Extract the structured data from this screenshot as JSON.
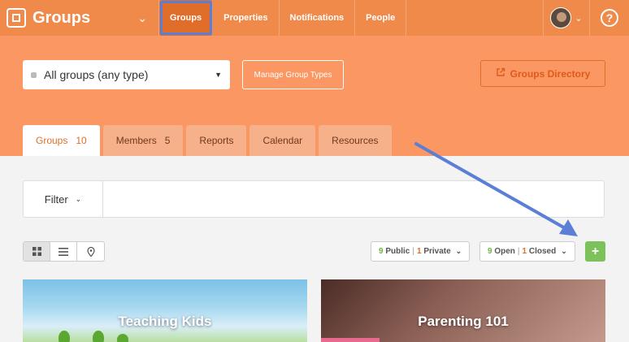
{
  "app": {
    "name": "Groups"
  },
  "topnav": {
    "items": [
      {
        "label": "Groups",
        "active": true
      },
      {
        "label": "Properties"
      },
      {
        "label": "Notifications"
      },
      {
        "label": "People"
      }
    ],
    "help_label": "?"
  },
  "header": {
    "group_select": {
      "value": "All groups (any type)"
    },
    "manage_button": "Manage Group Types",
    "directory_button": "Groups Directory"
  },
  "tabs": [
    {
      "label": "Groups",
      "count": "10",
      "active": true
    },
    {
      "label": "Members",
      "count": "5"
    },
    {
      "label": "Reports"
    },
    {
      "label": "Calendar"
    },
    {
      "label": "Resources"
    }
  ],
  "filter": {
    "label": "Filter"
  },
  "visibility_pill": {
    "public_count": "9",
    "public_label": "Public",
    "private_count": "1",
    "private_label": "Private"
  },
  "status_pill": {
    "open_count": "9",
    "open_label": "Open",
    "closed_count": "1",
    "closed_label": "Closed"
  },
  "add_button": "+",
  "cards": [
    {
      "title": "Teaching Kids"
    },
    {
      "title": "Parenting 101"
    }
  ],
  "colors": {
    "nav": "#f08a4b",
    "band": "#fb9762",
    "accent": "#e06e2a",
    "green": "#7cc15a",
    "highlight": "#5b7fd6"
  }
}
